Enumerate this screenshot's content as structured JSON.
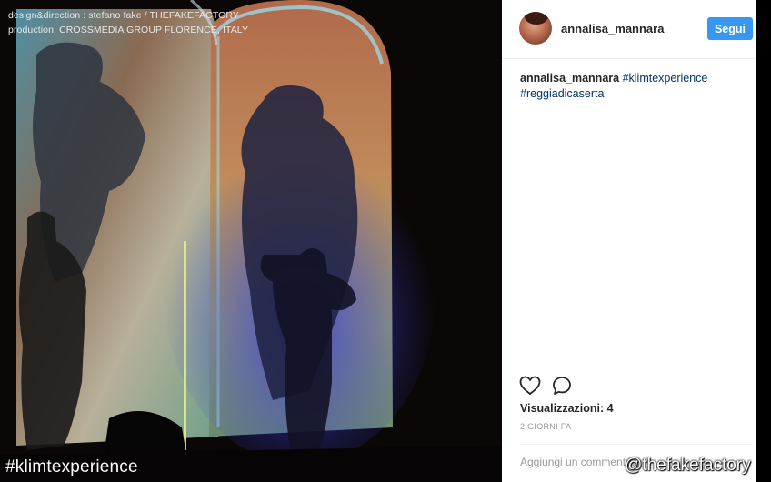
{
  "credits": {
    "line1": "design&direction : stefano fake / THEFAKEFACTORY",
    "line2": "production: CROSSMEDIA GROUP FLORENCE, ITALY"
  },
  "overlay": {
    "hashtag": "#klimtexperience",
    "watermark": "@thefakefactory"
  },
  "post": {
    "username": "annalisa_mannara",
    "follow_label": "Segui",
    "caption_user": "annalisa_mannara",
    "caption_tag1": "#klimtexperience",
    "caption_tag2": "#reggiadicaserta",
    "views_label": "Visualizzazioni: 4",
    "time_ago": "2 GIORNI FA",
    "comment_placeholder": "Aggiungi un commento..."
  },
  "icons": {
    "like": "heart-icon",
    "comment": "speech-bubble-icon"
  }
}
